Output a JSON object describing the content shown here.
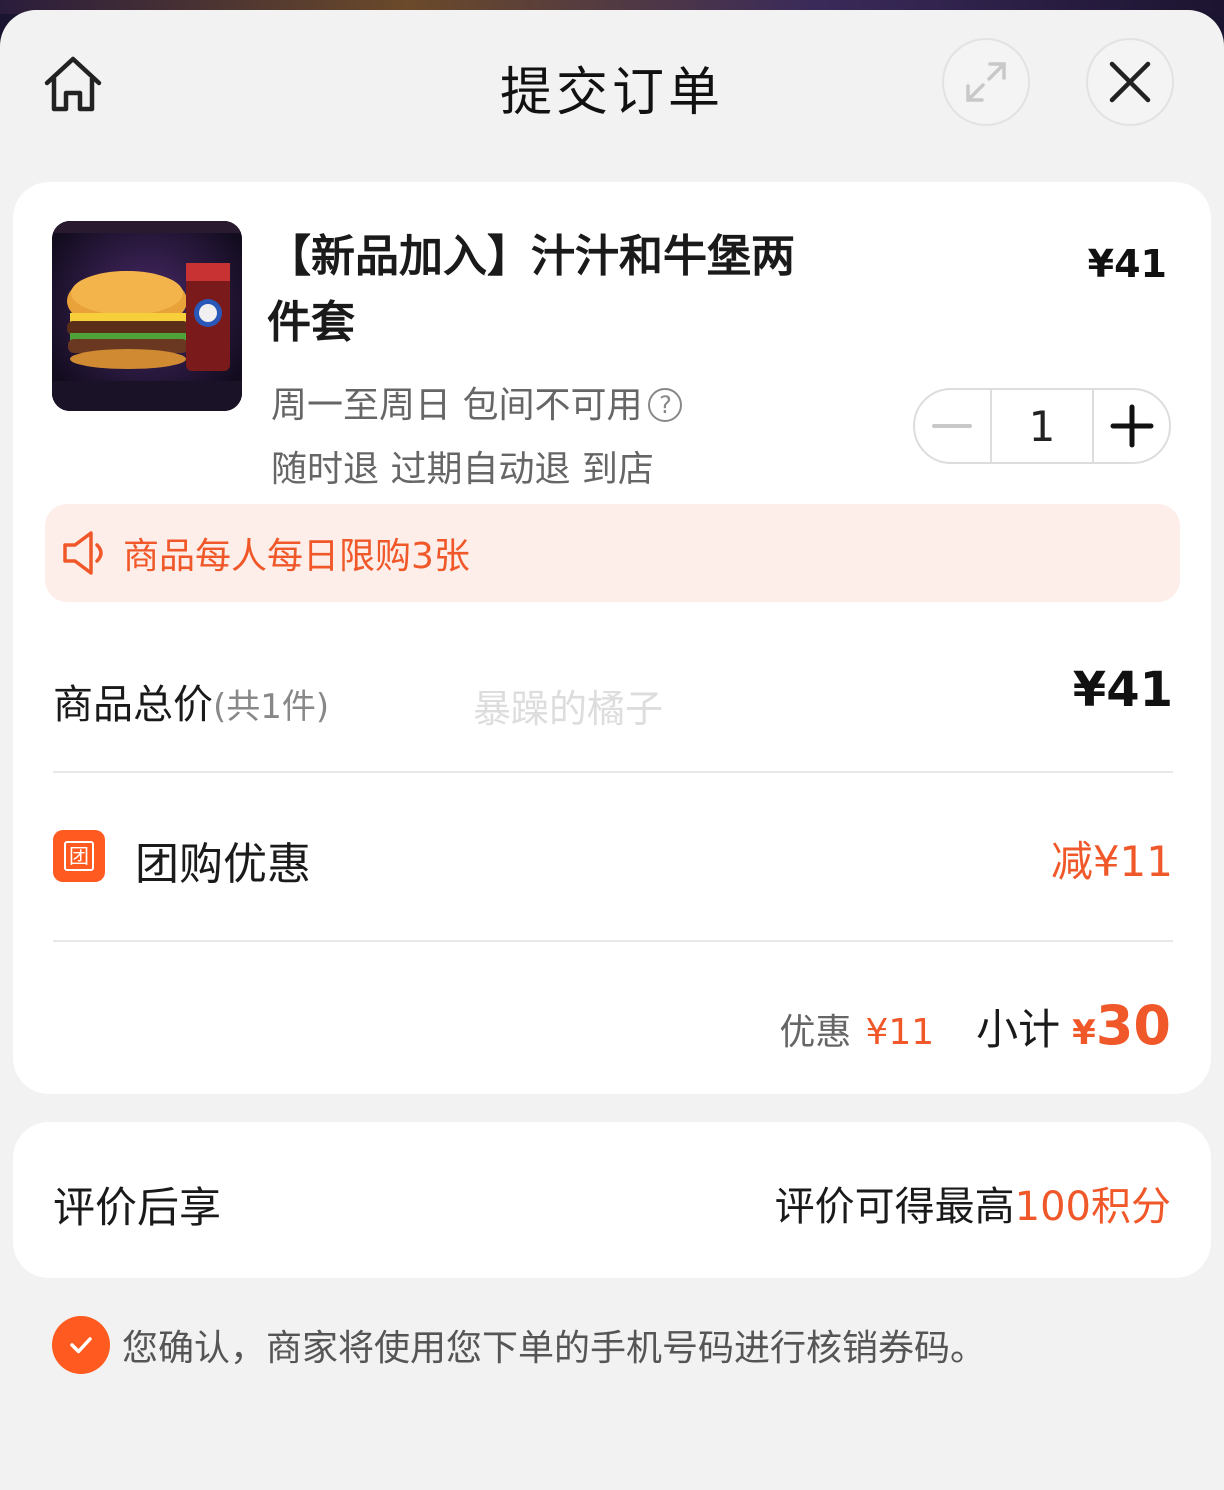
{
  "header": {
    "title": "提交订单"
  },
  "product": {
    "title": "【新品加入】汁汁和牛堡两件套",
    "price": "¥41",
    "tag_line1": "周一至周日 包间不可用",
    "tag_line2": "随时退 过期自动退 到店",
    "quantity": "1",
    "help_glyph": "?"
  },
  "notice": {
    "text": "商品每人每日限购3张"
  },
  "summary": {
    "total_label": "商品总价",
    "total_count": "(共1件)",
    "total_price": "¥41",
    "watermark": "暴躁的橘子",
    "discount_icon_text": "团",
    "discount_label": "团购优惠",
    "discount_value": "减¥11",
    "subtotal_discount_label": "优惠",
    "subtotal_discount_value": "¥11",
    "subtotal_label": "小计",
    "subtotal_yen": "¥",
    "subtotal_value": "30"
  },
  "review": {
    "label": "评价后享",
    "value_prefix": "评价可得最高",
    "value_accent": "100积分"
  },
  "confirm": {
    "text": "您确认，商家将使用您下单的手机号码进行核销券码。",
    "checked": true
  },
  "colors": {
    "accent": "#f0582a",
    "notice_bg": "#fdeee9",
    "page_bg": "#f2f2f2"
  }
}
